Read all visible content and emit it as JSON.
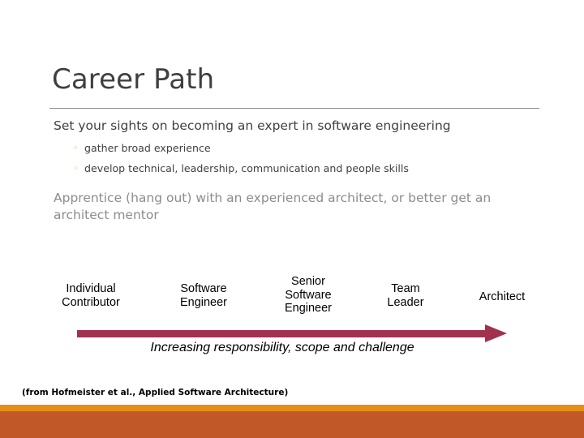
{
  "slide": {
    "title": "Career Path",
    "body": {
      "main_bullet": "Set your sights on becoming an expert in software engineering",
      "sub_bullets": [
        {
          "marker": "◦",
          "text": "gather broad experience"
        },
        {
          "marker": "◦",
          "text": "develop technical, leadership, communication and people skills"
        }
      ],
      "secondary_paragraph": "Apprentice (hang out) with an experienced architect, or better get an architect mentor"
    },
    "diagram": {
      "stages": [
        {
          "lines": [
            "Individual",
            "Contributor"
          ]
        },
        {
          "lines": [
            "Software",
            "Engineer"
          ]
        },
        {
          "lines": [
            "Senior",
            "Software",
            "Engineer"
          ]
        },
        {
          "lines": [
            "Team",
            "Leader"
          ]
        },
        {
          "lines": [
            "Architect"
          ]
        }
      ],
      "arrow_caption": "Increasing responsibility, scope and challenge",
      "arrow_color": "#a2304f"
    },
    "citation": "(from Hofmeister et al., Applied Software Architecture)",
    "colors": {
      "title_text": "#3f3f3f",
      "body_text": "#404040",
      "secondary_text": "#8c8c8c",
      "bullet_marker": "#d8b06a",
      "rule": "#8a8a8a",
      "bar_bright_orange": "#e58f14",
      "bar_dark_orange": "#c05827",
      "background": "#ffffff"
    }
  }
}
